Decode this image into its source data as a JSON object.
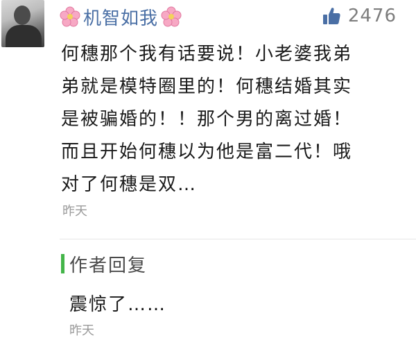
{
  "comment": {
    "username": "机智如我",
    "username_decoration": "cherry-blossom-emoji",
    "like_count": "2476",
    "text": "何穗那个我有话要说！小老婆我弟\n弟就是模特圈里的！何穗结婚其实\n是被骗婚的！！那个男的离过婚！\n而且开始何穗以为他是富二代！哦\n对了何穗是双…",
    "time": "昨天"
  },
  "reply": {
    "header": "作者回复",
    "text": "震惊了……",
    "time": "昨天"
  },
  "colors": {
    "username": "#4a6fa5",
    "like_icon": "#4a6fa5",
    "reply_accent": "#44b549",
    "secondary_text": "#9a9a9a"
  }
}
